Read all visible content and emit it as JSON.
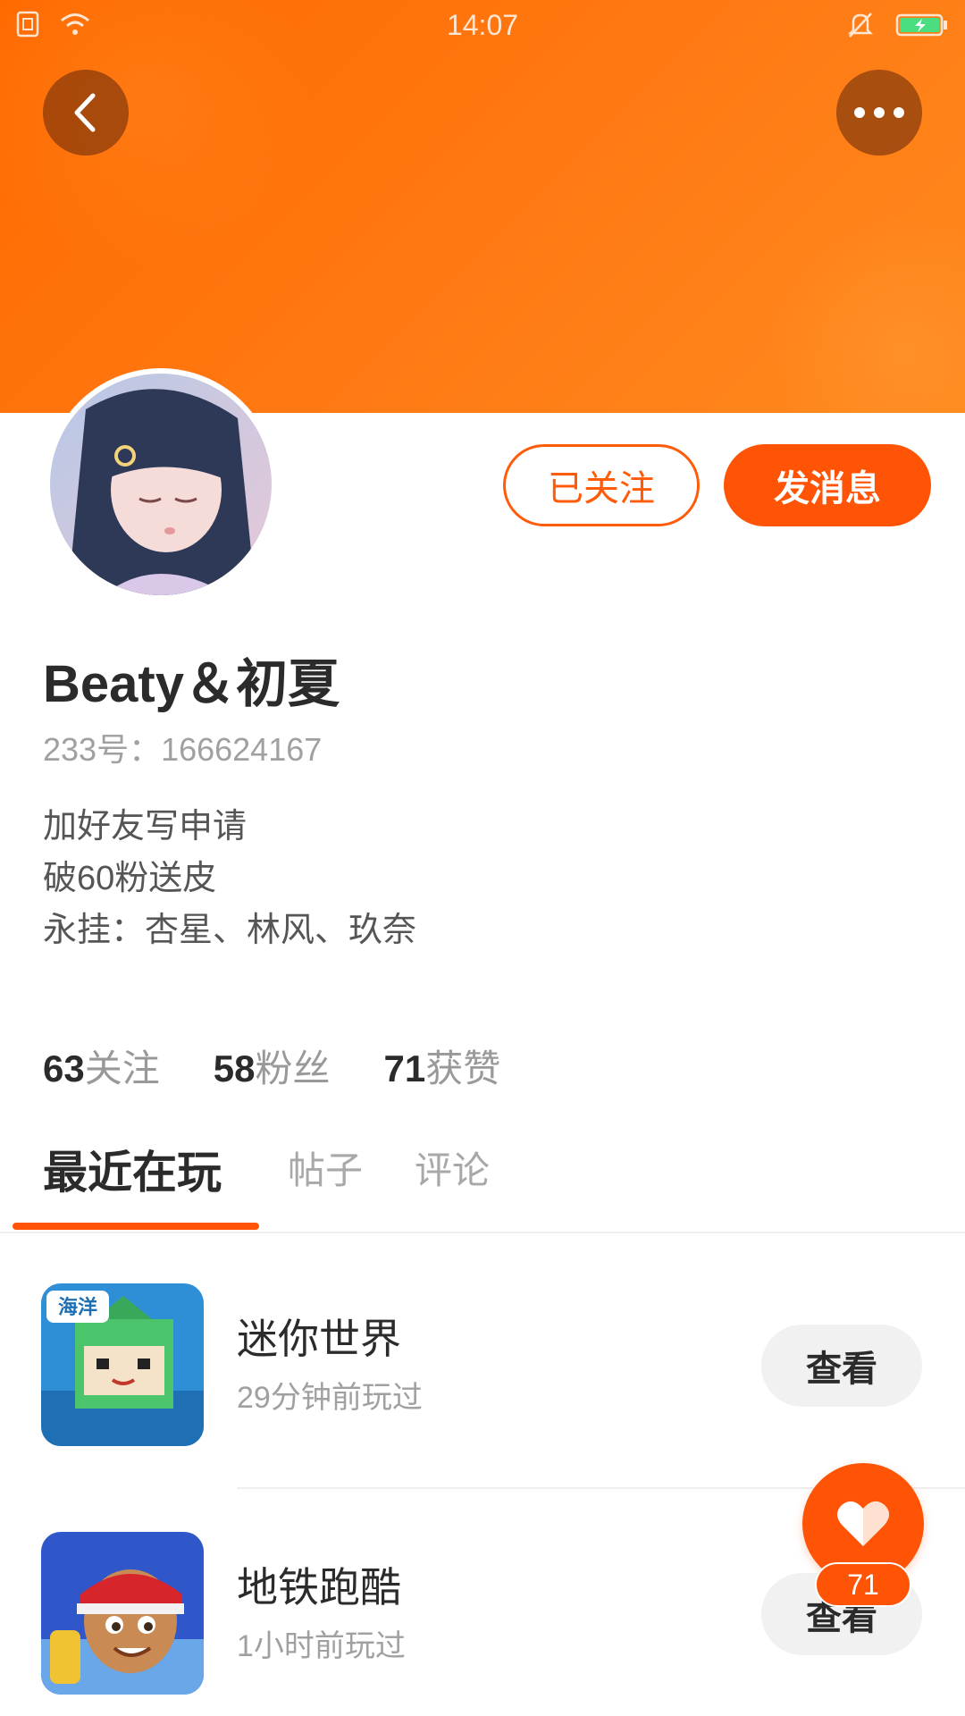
{
  "status_bar": {
    "time": "14:07"
  },
  "profile": {
    "username": "Beaty＆初夏",
    "id_text": "233号：166624167",
    "bio": [
      "加好友写申请",
      "破60粉送皮",
      "永挂：杏星、林风、玖奈"
    ]
  },
  "actions": {
    "followed_label": "已关注",
    "message_label": "发消息"
  },
  "stats": [
    {
      "num": "63",
      "label": "关注"
    },
    {
      "num": "58",
      "label": "粉丝"
    },
    {
      "num": "71",
      "label": "获赞"
    }
  ],
  "tabs": [
    "最近在玩",
    "帖子",
    "评论"
  ],
  "games": [
    {
      "name": "迷你世界",
      "time": "29分钟前玩过",
      "button": "查看",
      "badge": "海洋"
    },
    {
      "name": "地铁跑酷",
      "time": "1小时前玩过",
      "button": "查看"
    }
  ],
  "like": {
    "count": "71"
  },
  "colors": {
    "accent": "#ff5305",
    "header": "#ff7a14"
  }
}
